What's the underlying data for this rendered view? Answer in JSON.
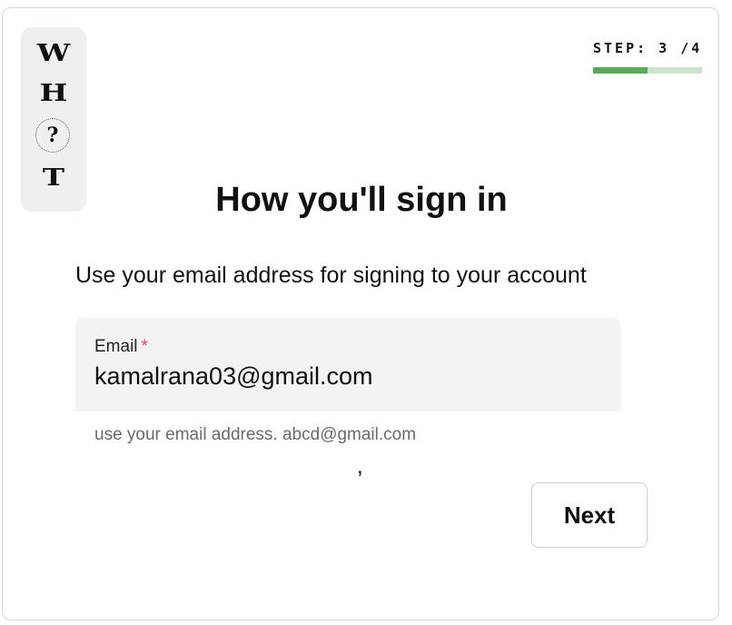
{
  "logo": {
    "letters": [
      "W",
      "H",
      "?",
      "T"
    ]
  },
  "step": {
    "text": "STEP: 3 /4",
    "current": 3,
    "total": 4,
    "progress_fraction": 0.5,
    "fill_color": "#5aa95a",
    "track_color": "#cfe3cc"
  },
  "title": "How you'll sign in",
  "subtitle": "Use your email address for signing to your account",
  "email_field": {
    "label": "Email",
    "required_mark": "*",
    "value": "kamalrana03@gmail.com",
    "helper": "use your email address. abcd@gmail.com"
  },
  "stray_text": ",",
  "next_button": {
    "label": "Next"
  },
  "colors": {
    "required": "#e0446a",
    "field_bg": "#f3f3f3"
  }
}
